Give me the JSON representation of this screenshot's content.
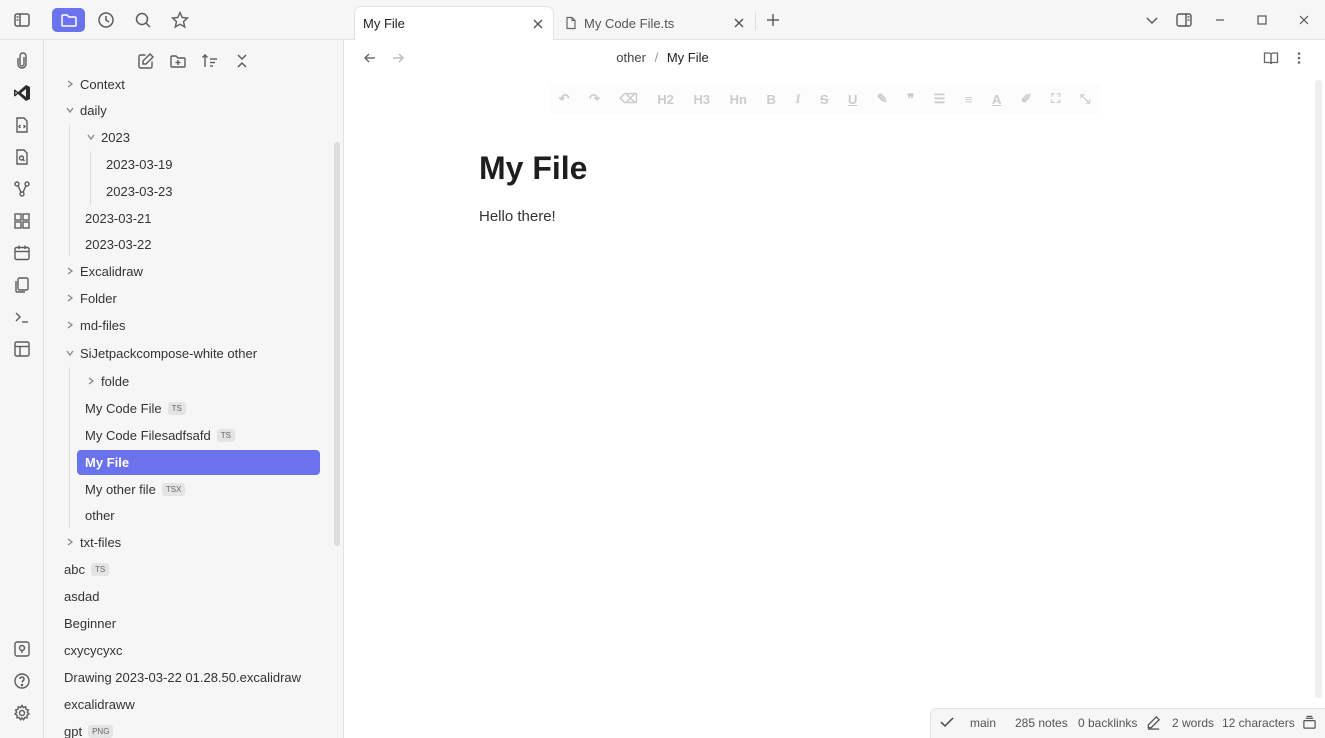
{
  "tabs": [
    {
      "label": "My File",
      "active": true
    },
    {
      "label": "My Code File.ts",
      "active": false
    }
  ],
  "breadcrumb": {
    "folder": "other",
    "separator": "/",
    "file": "My File"
  },
  "document": {
    "title": "My File",
    "body": "Hello there!"
  },
  "tree": [
    {
      "label": "Context"
    },
    {
      "label": "daily"
    },
    {
      "label": "2023"
    },
    {
      "label": "2023-03-19"
    },
    {
      "label": "2023-03-23"
    },
    {
      "label": "2023-03-21"
    },
    {
      "label": "2023-03-22"
    },
    {
      "label": "Excalidraw"
    },
    {
      "label": "Folder"
    },
    {
      "label": "md-files"
    },
    {
      "label": "SiJetpackcompose-white other"
    },
    {
      "label": "folde"
    },
    {
      "label": "My Code File",
      "badge": "TS"
    },
    {
      "label": "My Code Filesadfsafd",
      "badge": "TS"
    },
    {
      "label": "My File",
      "selected": true
    },
    {
      "label": "My other file",
      "badge": "TSX"
    },
    {
      "label": "other"
    },
    {
      "label": "txt-files"
    },
    {
      "label": "abc",
      "badge": "TS"
    },
    {
      "label": "asdad"
    },
    {
      "label": "Beginner"
    },
    {
      "label": "cxycycyxc"
    },
    {
      "label": "Drawing 2023-03-22 01.28.50.excalidraw"
    },
    {
      "label": "excalidraww"
    },
    {
      "label": "gpt",
      "badge": "PNG"
    }
  ],
  "status": {
    "branch": "main",
    "notes": "285 notes",
    "backlinks": "0 backlinks",
    "words": "2 words",
    "characters": "12 characters"
  },
  "format_toolbar": [
    "H2",
    "H3",
    "Hn"
  ],
  "colors": {
    "accent": "#6b72ee",
    "sidebar_bg": "#f6f6f6"
  }
}
